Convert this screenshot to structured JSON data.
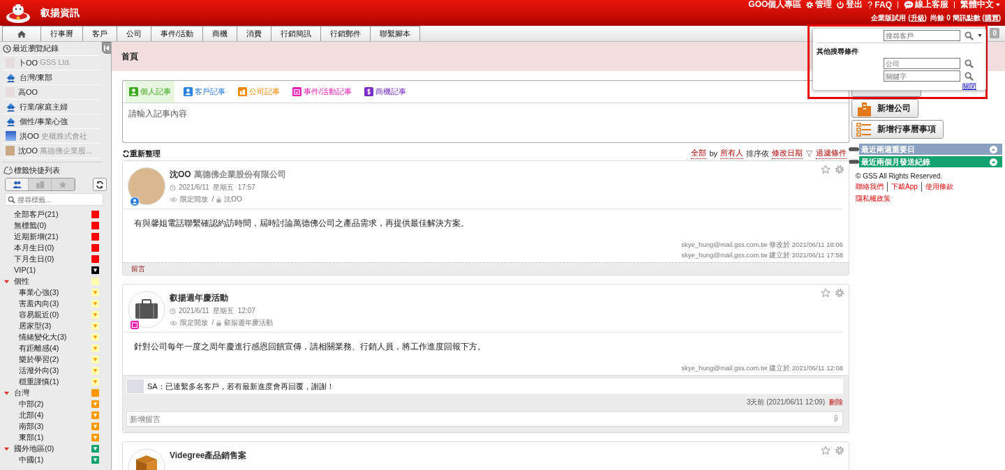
{
  "header": {
    "brand": "叡揚資訊",
    "links": [
      {
        "kind": "text",
        "label": "GOO個人專區"
      },
      {
        "kind": "gear",
        "label": "管理"
      },
      {
        "kind": "power",
        "label": "登出"
      },
      {
        "kind": "help",
        "label": "FAQ"
      },
      {
        "kind": "divider"
      },
      {
        "kind": "chat",
        "label": "線上客服"
      },
      {
        "kind": "divider"
      },
      {
        "kind": "language",
        "label": "繁體中文"
      }
    ],
    "account_parts": [
      {
        "kind": "text",
        "text": "企業版試用 ("
      },
      {
        "kind": "link",
        "text": "升級"
      },
      {
        "kind": "text",
        "text": ")  尚餘 0 簡訊點數 ("
      },
      {
        "kind": "link",
        "text": "購買"
      },
      {
        "kind": "text",
        "text": ")"
      }
    ]
  },
  "nav": {
    "tabs": [
      {
        "kind": "home"
      },
      {
        "kind": "text",
        "label": "行事曆"
      },
      {
        "kind": "text",
        "label": "客戶"
      },
      {
        "kind": "text",
        "label": "公司"
      },
      {
        "kind": "text",
        "label": "事件/活動"
      },
      {
        "kind": "text",
        "label": "商機"
      },
      {
        "kind": "text",
        "label": "消費"
      },
      {
        "kind": "text",
        "label": "行銷簡訊"
      },
      {
        "kind": "text",
        "label": "行銷郵件"
      },
      {
        "kind": "text",
        "label": "聯繫腳本"
      }
    ],
    "badge": "0"
  },
  "sidebar": {
    "recent_title": "最近瀏覽紀錄",
    "recent": [
      {
        "kind": "contact",
        "name": "卜OO",
        "company": "GSS Ltd."
      },
      {
        "kind": "group",
        "name": "台灣/東部"
      },
      {
        "kind": "contact",
        "name": "高OO"
      },
      {
        "kind": "group",
        "name": "行業/家庭主婦"
      },
      {
        "kind": "group",
        "name": "個性/事業心強"
      },
      {
        "kind": "company",
        "name": "洪OO",
        "company": "史概株式會社"
      },
      {
        "kind": "photo",
        "name": "沈OO",
        "company": "萬德佛企業股..."
      }
    ],
    "tags_title": "標籤快捷列表",
    "modes": [
      {
        "kind": "people",
        "selected": true
      },
      {
        "kind": "building",
        "selected": false
      },
      {
        "kind": "star",
        "selected": false
      }
    ],
    "search_placeholder": "搜尋標籤...",
    "tags": [
      {
        "label": "全部客戶(21)",
        "color": "#ff0000",
        "kind": "plain"
      },
      {
        "label": "無標籤(0)",
        "color": "#ff0000",
        "kind": "plain"
      },
      {
        "label": "近期新增(21)",
        "color": "#ff0000",
        "kind": "plain"
      },
      {
        "label": "本月生日(0)",
        "color": "#ff0000",
        "kind": "plain"
      },
      {
        "label": "下月生日(0)",
        "color": "#ff0000",
        "kind": "plain"
      },
      {
        "label": "VIP(1)",
        "color": "#000000",
        "kind": "filter"
      },
      {
        "label": "個性",
        "color": "#ffffb0",
        "kind": "plain",
        "expanded": true,
        "children": [
          {
            "label": "事業心強(3)",
            "color": "#ffffb0",
            "kind": "filter"
          },
          {
            "label": "害羞內向(3)",
            "color": "#ffffb0",
            "kind": "filter"
          },
          {
            "label": "容易親近(0)",
            "color": "#ffffb0",
            "kind": "filter"
          },
          {
            "label": "居家型(3)",
            "color": "#ffffb0",
            "kind": "filter"
          },
          {
            "label": "情緒變化大(3)",
            "color": "#ffffb0",
            "kind": "filter"
          },
          {
            "label": "有距離感(4)",
            "color": "#ffffb0",
            "kind": "filter"
          },
          {
            "label": "樂於學習(2)",
            "color": "#ffffb0",
            "kind": "filter"
          },
          {
            "label": "活潑外向(3)",
            "color": "#ffffb0",
            "kind": "filter"
          },
          {
            "label": "穩重謹慎(1)",
            "color": "#ffffb0",
            "kind": "filter"
          }
        ]
      },
      {
        "label": "台灣",
        "color": "#ff9900",
        "kind": "plain",
        "expanded": true,
        "children": [
          {
            "label": "中部(2)",
            "color": "#ff9900",
            "kind": "filter"
          },
          {
            "label": "北部(4)",
            "color": "#ff9900",
            "kind": "filter"
          },
          {
            "label": "南部(3)",
            "color": "#ff9900",
            "kind": "filter"
          },
          {
            "label": "東部(1)",
            "color": "#ff9900",
            "kind": "filter"
          }
        ]
      },
      {
        "label": "國外地區(0)",
        "color": "#16a36e",
        "kind": "filter",
        "expanded": true,
        "children": [
          {
            "label": "中國(1)",
            "color": "#16a36e",
            "kind": "filter"
          }
        ]
      }
    ]
  },
  "page_title": "首頁",
  "composer": {
    "tabs": [
      {
        "label": "個人記事",
        "color": "#3caa1e",
        "kind": "person",
        "selected": true
      },
      {
        "label": "客戶記事",
        "color": "#2a7fe0",
        "kind": "customer",
        "selected": false
      },
      {
        "label": "公司記事",
        "color": "#f08a00",
        "kind": "company",
        "selected": false
      },
      {
        "label": "事件/活動記事",
        "color": "#e81fb4",
        "kind": "event",
        "selected": false
      },
      {
        "label": "商機記事",
        "color": "#7a2fc8",
        "kind": "deal",
        "selected": false
      }
    ],
    "placeholder": "請輸入記事內容"
  },
  "feed_toolbar": {
    "refresh": "重新整理",
    "filters": [
      {
        "kind": "link",
        "text": "全部"
      },
      {
        "kind": "text",
        "text": "by"
      },
      {
        "kind": "link",
        "text": "所有人"
      },
      {
        "kind": "text",
        "text": "排序依"
      },
      {
        "kind": "link",
        "text": "修改日期"
      },
      {
        "kind": "filter",
        "text": "過濾條件"
      }
    ]
  },
  "posts": [
    {
      "avatar": {
        "kind": "photo"
      },
      "badge": {
        "kind": "customer"
      },
      "name": "沈OO",
      "company": "萬德佛企業股份有限公司",
      "date": "2021/6/11  星期五  17:57",
      "access": "限定開放  /",
      "owner": "沈OO",
      "body": "有與馨姐電話聯繫確認約訪時間，屆時討論萬德佛公司之產品需求，再提供最佳解決方案。",
      "meta": [
        "skye_hung@mail.gss.com.tw 修改於 2021/06/11 18:06",
        "skye_hung@mail.gss.com.tw 建立於 2021/06/11 17:58"
      ],
      "comment_link": "留言"
    },
    {
      "avatar": {
        "kind": "briefcase"
      },
      "badge": {
        "kind": "event"
      },
      "name": "叡揚週年慶活動",
      "date": "2021/6/11  星期五  12:07",
      "access": "限定開放  /",
      "owner": "叡揚週年慶活動",
      "body": "針對公司每年一度之周年慶進行感恩回饋宣傳，請相關業務、行銷人員，將工作進度回報下方。",
      "meta": [
        "skye_hung@mail.gss.com.tw 建立於 2021/06/11 12:08"
      ],
      "comments": [
        {
          "text": "SA：已連繫多名客戶，若有最新進度會再回覆，謝謝！",
          "time": "3天前 (2021/06/11 12:09)",
          "delete": "刪除"
        }
      ],
      "new_comment_placeholder": "新增留言"
    },
    {
      "avatar": {
        "kind": "box"
      },
      "name": "Videgree產品銷售案"
    }
  ],
  "quick_actions": [
    {
      "kind": "customer"
    },
    {
      "kind": "company",
      "label": "新增公司"
    },
    {
      "kind": "calendar",
      "label": "新增行事曆事項"
    }
  ],
  "panels": [
    {
      "title": "最近兩週重要日",
      "color": "#8aa0bf"
    },
    {
      "title": "最近兩個月發送紀錄",
      "color": "#14a36f"
    }
  ],
  "footer": {
    "copyright": "© GSS All Rights Reserved.",
    "links": [
      "聯絡我們",
      "下載App",
      "使用條款",
      "隱私權政策"
    ]
  },
  "search_popup": {
    "placeholder": "搜尋客戶",
    "more_label": "其他搜尋條件",
    "fields": [
      {
        "placeholder": "公司"
      },
      {
        "placeholder": "關鍵字"
      }
    ],
    "close": "關閉"
  }
}
